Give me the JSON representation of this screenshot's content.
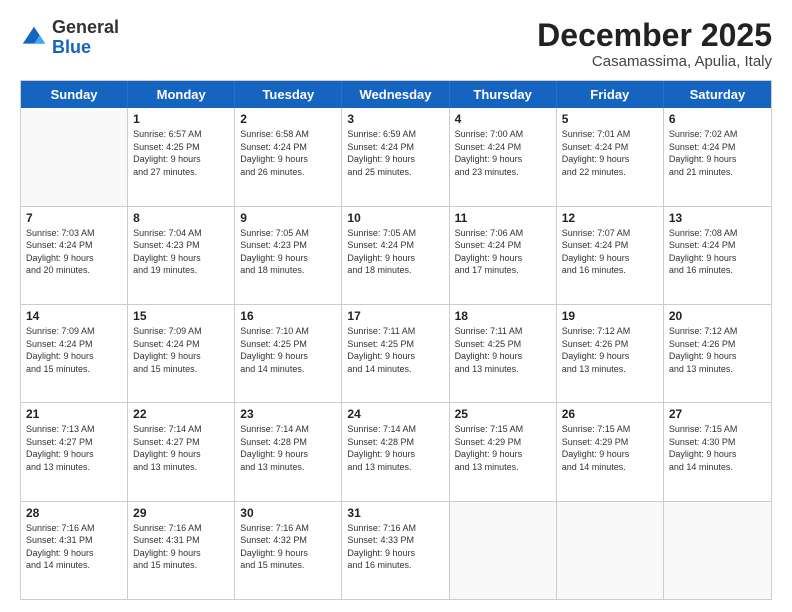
{
  "logo": {
    "general": "General",
    "blue": "Blue"
  },
  "header": {
    "month": "December 2025",
    "location": "Casamassima, Apulia, Italy"
  },
  "weekdays": [
    "Sunday",
    "Monday",
    "Tuesday",
    "Wednesday",
    "Thursday",
    "Friday",
    "Saturday"
  ],
  "weeks": [
    [
      {
        "day": "",
        "info": ""
      },
      {
        "day": "1",
        "info": "Sunrise: 6:57 AM\nSunset: 4:25 PM\nDaylight: 9 hours\nand 27 minutes."
      },
      {
        "day": "2",
        "info": "Sunrise: 6:58 AM\nSunset: 4:24 PM\nDaylight: 9 hours\nand 26 minutes."
      },
      {
        "day": "3",
        "info": "Sunrise: 6:59 AM\nSunset: 4:24 PM\nDaylight: 9 hours\nand 25 minutes."
      },
      {
        "day": "4",
        "info": "Sunrise: 7:00 AM\nSunset: 4:24 PM\nDaylight: 9 hours\nand 23 minutes."
      },
      {
        "day": "5",
        "info": "Sunrise: 7:01 AM\nSunset: 4:24 PM\nDaylight: 9 hours\nand 22 minutes."
      },
      {
        "day": "6",
        "info": "Sunrise: 7:02 AM\nSunset: 4:24 PM\nDaylight: 9 hours\nand 21 minutes."
      }
    ],
    [
      {
        "day": "7",
        "info": "Sunrise: 7:03 AM\nSunset: 4:24 PM\nDaylight: 9 hours\nand 20 minutes."
      },
      {
        "day": "8",
        "info": "Sunrise: 7:04 AM\nSunset: 4:23 PM\nDaylight: 9 hours\nand 19 minutes."
      },
      {
        "day": "9",
        "info": "Sunrise: 7:05 AM\nSunset: 4:23 PM\nDaylight: 9 hours\nand 18 minutes."
      },
      {
        "day": "10",
        "info": "Sunrise: 7:05 AM\nSunset: 4:24 PM\nDaylight: 9 hours\nand 18 minutes."
      },
      {
        "day": "11",
        "info": "Sunrise: 7:06 AM\nSunset: 4:24 PM\nDaylight: 9 hours\nand 17 minutes."
      },
      {
        "day": "12",
        "info": "Sunrise: 7:07 AM\nSunset: 4:24 PM\nDaylight: 9 hours\nand 16 minutes."
      },
      {
        "day": "13",
        "info": "Sunrise: 7:08 AM\nSunset: 4:24 PM\nDaylight: 9 hours\nand 16 minutes."
      }
    ],
    [
      {
        "day": "14",
        "info": "Sunrise: 7:09 AM\nSunset: 4:24 PM\nDaylight: 9 hours\nand 15 minutes."
      },
      {
        "day": "15",
        "info": "Sunrise: 7:09 AM\nSunset: 4:24 PM\nDaylight: 9 hours\nand 15 minutes."
      },
      {
        "day": "16",
        "info": "Sunrise: 7:10 AM\nSunset: 4:25 PM\nDaylight: 9 hours\nand 14 minutes."
      },
      {
        "day": "17",
        "info": "Sunrise: 7:11 AM\nSunset: 4:25 PM\nDaylight: 9 hours\nand 14 minutes."
      },
      {
        "day": "18",
        "info": "Sunrise: 7:11 AM\nSunset: 4:25 PM\nDaylight: 9 hours\nand 13 minutes."
      },
      {
        "day": "19",
        "info": "Sunrise: 7:12 AM\nSunset: 4:26 PM\nDaylight: 9 hours\nand 13 minutes."
      },
      {
        "day": "20",
        "info": "Sunrise: 7:12 AM\nSunset: 4:26 PM\nDaylight: 9 hours\nand 13 minutes."
      }
    ],
    [
      {
        "day": "21",
        "info": "Sunrise: 7:13 AM\nSunset: 4:27 PM\nDaylight: 9 hours\nand 13 minutes."
      },
      {
        "day": "22",
        "info": "Sunrise: 7:14 AM\nSunset: 4:27 PM\nDaylight: 9 hours\nand 13 minutes."
      },
      {
        "day": "23",
        "info": "Sunrise: 7:14 AM\nSunset: 4:28 PM\nDaylight: 9 hours\nand 13 minutes."
      },
      {
        "day": "24",
        "info": "Sunrise: 7:14 AM\nSunset: 4:28 PM\nDaylight: 9 hours\nand 13 minutes."
      },
      {
        "day": "25",
        "info": "Sunrise: 7:15 AM\nSunset: 4:29 PM\nDaylight: 9 hours\nand 13 minutes."
      },
      {
        "day": "26",
        "info": "Sunrise: 7:15 AM\nSunset: 4:29 PM\nDaylight: 9 hours\nand 14 minutes."
      },
      {
        "day": "27",
        "info": "Sunrise: 7:15 AM\nSunset: 4:30 PM\nDaylight: 9 hours\nand 14 minutes."
      }
    ],
    [
      {
        "day": "28",
        "info": "Sunrise: 7:16 AM\nSunset: 4:31 PM\nDaylight: 9 hours\nand 14 minutes."
      },
      {
        "day": "29",
        "info": "Sunrise: 7:16 AM\nSunset: 4:31 PM\nDaylight: 9 hours\nand 15 minutes."
      },
      {
        "day": "30",
        "info": "Sunrise: 7:16 AM\nSunset: 4:32 PM\nDaylight: 9 hours\nand 15 minutes."
      },
      {
        "day": "31",
        "info": "Sunrise: 7:16 AM\nSunset: 4:33 PM\nDaylight: 9 hours\nand 16 minutes."
      },
      {
        "day": "",
        "info": ""
      },
      {
        "day": "",
        "info": ""
      },
      {
        "day": "",
        "info": ""
      }
    ]
  ]
}
